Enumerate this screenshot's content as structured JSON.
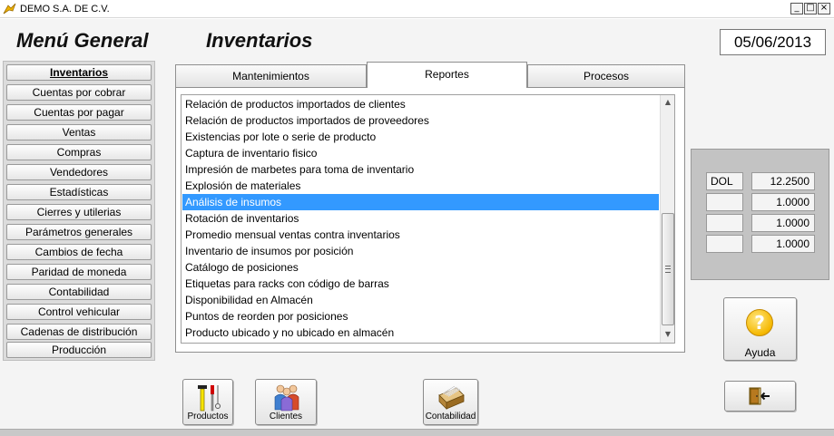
{
  "window": {
    "title": "DEMO  S.A. DE C.V.",
    "app_icon": "yellow-bird-icon",
    "controls": [
      "minimize-icon",
      "maximize-icon",
      "close-icon"
    ]
  },
  "header": {
    "menu_title": "Menú General",
    "section_title": "Inventarios",
    "date": "05/06/2013"
  },
  "sidebar": {
    "items": [
      {
        "label": "Inventarios",
        "active": true
      },
      {
        "label": "Cuentas por cobrar"
      },
      {
        "label": "Cuentas por pagar"
      },
      {
        "label": "Ventas"
      },
      {
        "label": "Compras"
      },
      {
        "label": "Vendedores"
      },
      {
        "label": "Estadísticas"
      },
      {
        "label": "Cierres y utilerias"
      },
      {
        "label": "Parámetros generales"
      },
      {
        "label": "Cambios de fecha"
      },
      {
        "label": "Paridad de moneda"
      },
      {
        "label": "Contabilidad"
      },
      {
        "label": "Control vehicular"
      },
      {
        "label": "Cadenas de distribución"
      },
      {
        "label": "Producción"
      }
    ]
  },
  "tabs": [
    {
      "label": "Mantenimientos"
    },
    {
      "label": "Reportes",
      "active": true
    },
    {
      "label": "Procesos"
    }
  ],
  "reports": {
    "items": [
      "Relación de productos importados de clientes",
      "Relación de productos importados de proveedores",
      "Existencias por lote o serie de producto",
      "Captura de inventario fisico",
      "Impresión de marbetes para toma de inventario",
      "Explosión de materiales",
      "Análisis de  insumos",
      "Rotación de inventarios",
      "Promedio mensual ventas contra inventarios",
      "Inventario de insumos por posición",
      "Catálogo de posiciones",
      "Etiquetas para racks con código de barras",
      "Disponibilidad en Almacén",
      "Puntos de reorden por posiciones",
      "Producto ubicado y no ubicado en almacén"
    ],
    "selected_index": 6,
    "scroll_up_icon": "scroll-up-arrow-icon",
    "scroll_down_icon": "scroll-down-arrow-icon"
  },
  "currencies": {
    "rows": [
      {
        "code": "DOL",
        "rate": "12.2500"
      },
      {
        "code": "",
        "rate": "1.0000"
      },
      {
        "code": "",
        "rate": "1.0000"
      },
      {
        "code": "",
        "rate": "1.0000"
      }
    ]
  },
  "buttons": {
    "help_label": "Ayuda",
    "help_icon": "question-mark-icon",
    "exit_icon": "exit-door-icon",
    "products_label": "Productos",
    "products_icon": "tools-icon",
    "clients_label": "Clientes",
    "clients_icon": "people-icon",
    "accounting_label": "Contabilidad",
    "accounting_icon": "card-file-icon"
  },
  "colors": {
    "selection": "#3399ff",
    "help_icon": "#f5b800"
  }
}
